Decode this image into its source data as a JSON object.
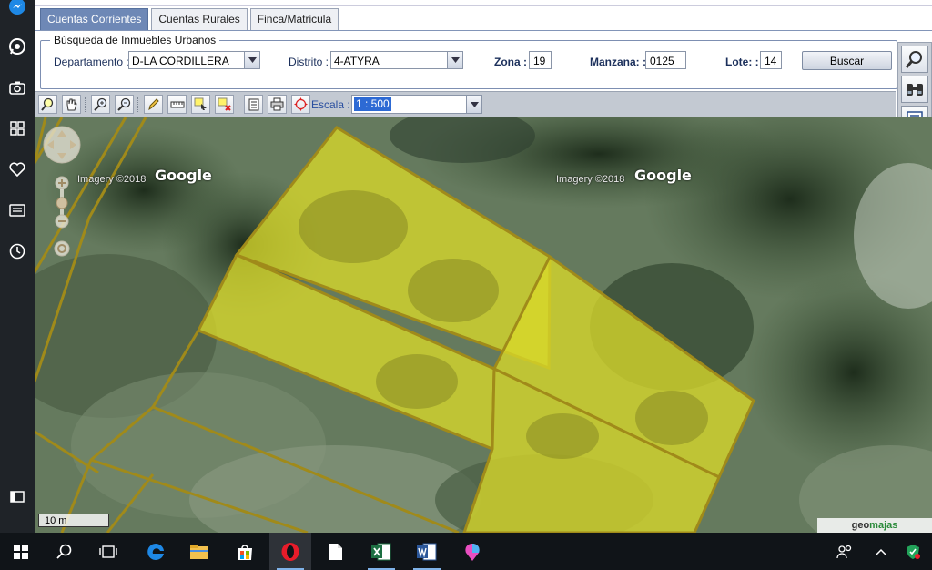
{
  "tabs": [
    {
      "label": "Cuentas Corrientes",
      "active": true
    },
    {
      "label": "Cuentas Rurales",
      "active": false
    },
    {
      "label": "Finca/Matricula",
      "active": false
    }
  ],
  "search": {
    "legend": "Búsqueda de Inmuebles Urbanos",
    "departamento_label": "Departamento :",
    "departamento_value": "D-LA CORDILLERA",
    "distrito_label": "Distrito :",
    "distrito_value": "4-ATYRA",
    "zona_label": "Zona :",
    "zona_value": "19",
    "manzana_label": "Manzana: :",
    "manzana_value": "0125",
    "lote_label": "Lote: :",
    "lote_value": "14",
    "buscar_label": "Buscar"
  },
  "map_toolbar": {
    "escala_label": "Escala :",
    "escala_value": "1 : 500"
  },
  "map": {
    "google_label_1": "Google",
    "imagery_label_1": "Imagery ©2018",
    "google_label_2": "Google",
    "imagery_label_2": "Imagery ©2018",
    "scale_bar_label": "10 m",
    "brand_geo": "geo",
    "brand_majas": "majas",
    "parcel_fill_color": "#d8d82a",
    "parcel_line_color": "#a08a1a"
  },
  "icons": {
    "sidebar": [
      "messenger-icon",
      "whatsapp-icon",
      "camera-icon",
      "speed-dial-icon",
      "heart-icon",
      "news-icon",
      "history-icon",
      "sidebar-toggle-icon"
    ],
    "taskbar": [
      "windows-start-icon",
      "search-icon",
      "task-view-icon",
      "edge-icon",
      "file-explorer-icon",
      "store-icon",
      "opera-icon",
      "file-icon",
      "excel-icon",
      "word-icon",
      "paint3d-icon"
    ],
    "tray": [
      "people-icon",
      "chevron-up-icon",
      "defender-icon"
    ]
  }
}
